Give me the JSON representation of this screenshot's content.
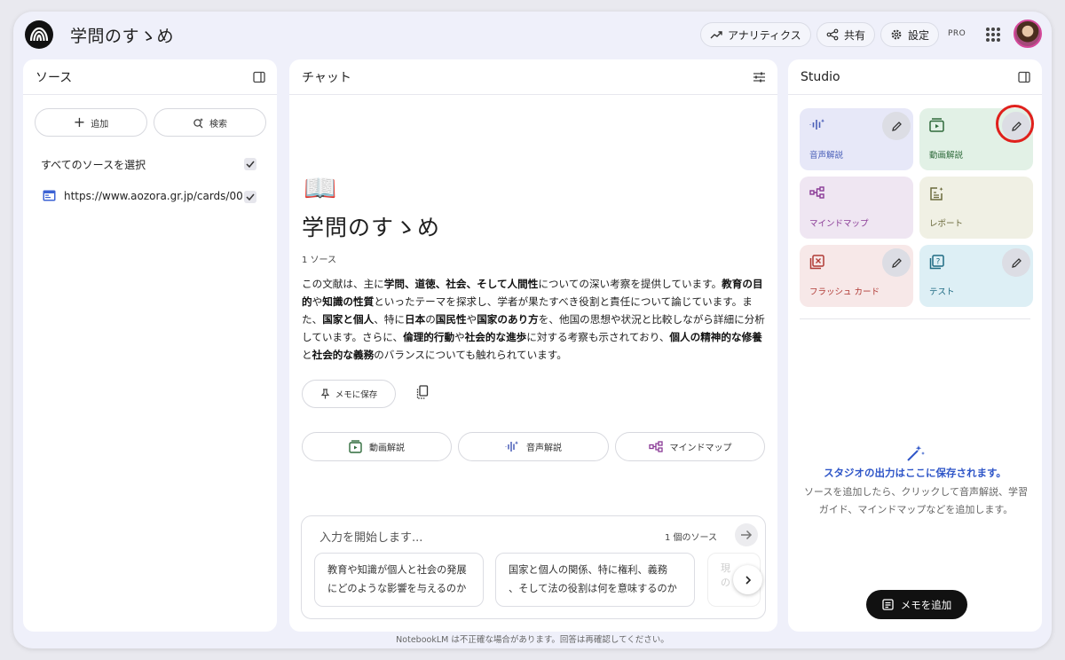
{
  "header": {
    "title": "学問のすゝめ",
    "analytics_label": "アナリティクス",
    "share_label": "共有",
    "settings_label": "設定",
    "plan_badge": "PRO"
  },
  "sources": {
    "title": "ソース",
    "add_label": "追加",
    "search_label": "検索",
    "select_all_label": "すべてのソースを選択",
    "items": [
      {
        "label": "https://www.aozora.gr.jp/cards/00...",
        "checked": true
      }
    ]
  },
  "chat": {
    "title": "チャット",
    "emoji": "📖",
    "notebook_title": "学問のすゝめ",
    "source_count": "1 ソース",
    "summary": [
      {
        "t": "この文献は、主に",
        "b": false
      },
      {
        "t": "学問、道徳、社会、そして人間性",
        "b": true
      },
      {
        "t": "についての深い考察を提供しています。",
        "b": false
      },
      {
        "t": "教育の目的",
        "b": true
      },
      {
        "t": "や",
        "b": false
      },
      {
        "t": "知識の性質",
        "b": true
      },
      {
        "t": "といったテーマを探求し、学者が果たすべき役割と責任について論じています。また、",
        "b": false
      },
      {
        "t": "国家と個人",
        "b": true
      },
      {
        "t": "、特に",
        "b": false
      },
      {
        "t": "日本",
        "b": true
      },
      {
        "t": "の",
        "b": false
      },
      {
        "t": "国民性",
        "b": true
      },
      {
        "t": "や",
        "b": false
      },
      {
        "t": "国家のあり方",
        "b": true
      },
      {
        "t": "を、他国の思想や状況と比較しながら詳細に分析しています。さらに、",
        "b": false
      },
      {
        "t": "倫理的行動",
        "b": true
      },
      {
        "t": "や",
        "b": false
      },
      {
        "t": "社会的な進歩",
        "b": true
      },
      {
        "t": "に対する考察も示されており、",
        "b": false
      },
      {
        "t": "個人の精神的な修養",
        "b": true
      },
      {
        "t": "と",
        "b": false
      },
      {
        "t": "社会的な義務",
        "b": true
      },
      {
        "t": "のバランスについても触れられています。",
        "b": false
      }
    ],
    "save_memo_label": "メモに保存",
    "feature_buttons": [
      "動画解説",
      "音声解説",
      "マインドマップ"
    ],
    "input_placeholder": "入力を開始します...",
    "input_source_count": "1 個のソース",
    "suggestions": [
      [
        "教育や知識が個人と社会の発展",
        "にどのような影響を与えるのか"
      ],
      [
        "国家と個人の関係、特に権利、義務",
        "、そして法の役割は何を意味するのか"
      ],
      [
        "現",
        "の"
      ]
    ]
  },
  "studio": {
    "title": "Studio",
    "tiles": [
      {
        "label": "音声解説",
        "bg": "#e7e8f8",
        "color": "#4a5fb8",
        "edit": true
      },
      {
        "label": "動画解説",
        "bg": "#e2f1e6",
        "color": "#2f6b3b",
        "edit": true
      },
      {
        "label": "マインドマップ",
        "bg": "#efe6f2",
        "color": "#8a3a96",
        "edit": false
      },
      {
        "label": "レポート",
        "bg": "#f0f0e4",
        "color": "#6b6a3c",
        "edit": false
      },
      {
        "label": "フラッシュ カード",
        "bg": "#f7e8e8",
        "color": "#b03a35",
        "edit": true
      },
      {
        "label": "テスト",
        "bg": "#ddeff5",
        "color": "#1f6b83",
        "edit": true
      }
    ],
    "empty_title": "スタジオの出力はここに保存されます。",
    "empty_desc": "ソースを追加したら、クリックして音声解説、学習ガイド、マインドマップなどを追加します。",
    "add_memo_label": "メモを追加"
  },
  "footer": {
    "disclaimer": "NotebookLM は不正確な場合があります。回答は再確認してください。"
  },
  "colors": {
    "accent": "#2f56c8",
    "highlight_ring": "#e0201c"
  }
}
